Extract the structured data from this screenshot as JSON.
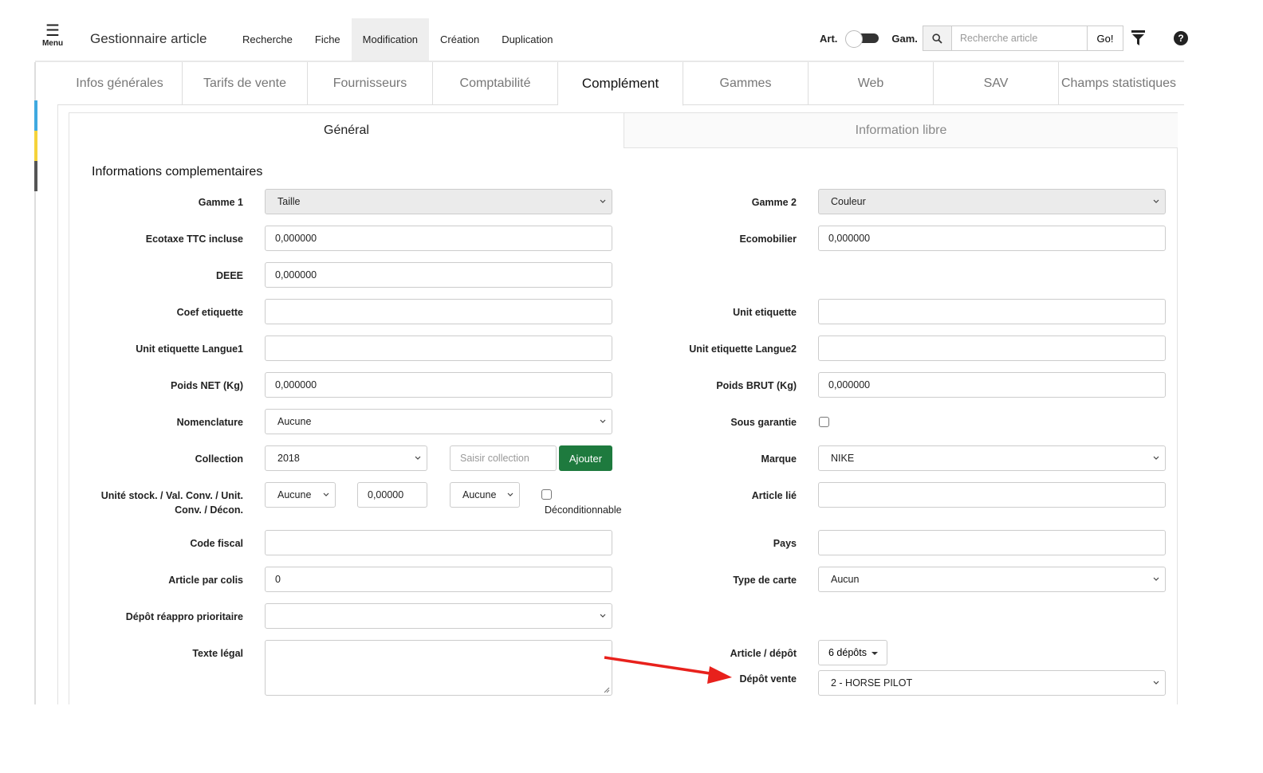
{
  "header": {
    "menu_label": "Menu",
    "app_title": "Gestionnaire article",
    "nav": [
      "Recherche",
      "Fiche",
      "Modification",
      "Création",
      "Duplication"
    ],
    "toggle_left": "Art.",
    "toggle_right": "Gam.",
    "search_placeholder": "Recherche article",
    "go_label": "Go!"
  },
  "tabs": [
    "Infos générales",
    "Tarifs de vente",
    "Fournisseurs",
    "Comptabilité",
    "Complément",
    "Gammes",
    "Web",
    "SAV",
    "Champs statistiques"
  ],
  "active_tab": "Complément",
  "subtabs": [
    "Général",
    "Information libre"
  ],
  "section_title": "Informations complementaires",
  "form": {
    "gamme1": {
      "label": "Gamme 1",
      "value": "Taille"
    },
    "gamme2": {
      "label": "Gamme 2",
      "value": "Couleur"
    },
    "ecotaxe": {
      "label": "Ecotaxe TTC incluse",
      "value": "0,000000"
    },
    "ecomobilier": {
      "label": "Ecomobilier",
      "value": "0,000000"
    },
    "deee": {
      "label": "DEEE",
      "value": "0,000000"
    },
    "coef_etiquette": {
      "label": "Coef etiquette",
      "value": ""
    },
    "unit_etiquette": {
      "label": "Unit etiquette",
      "value": ""
    },
    "unit_langue1": {
      "label": "Unit etiquette Langue1",
      "value": ""
    },
    "unit_langue2": {
      "label": "Unit etiquette Langue2",
      "value": ""
    },
    "poids_net": {
      "label": "Poids NET (Kg)",
      "value": "0,000000"
    },
    "poids_brut": {
      "label": "Poids BRUT (Kg)",
      "value": "0,000000"
    },
    "nomenclature": {
      "label": "Nomenclature",
      "value": "Aucune"
    },
    "sous_garantie": {
      "label": "Sous garantie",
      "checked": false
    },
    "collection": {
      "label": "Collection",
      "value": "2018",
      "input_placeholder": "Saisir collection",
      "button": "Ajouter"
    },
    "marque": {
      "label": "Marque",
      "value": "NIKE"
    },
    "unite_stock": {
      "label_line1": "Unité stock. / Val. Conv. / Unit.",
      "label_line2": "Conv. / Décon.",
      "unit1": "Aucune",
      "val_conv": "0,00000",
      "unit2": "Aucune",
      "decond_label": "Déconditionnable"
    },
    "article_lie": {
      "label": "Article lié",
      "value": ""
    },
    "code_fiscal": {
      "label": "Code fiscal",
      "value": ""
    },
    "pays": {
      "label": "Pays",
      "value": ""
    },
    "article_colis": {
      "label": "Article par colis",
      "value": "0"
    },
    "type_carte": {
      "label": "Type de carte",
      "value": "Aucun"
    },
    "depot_reappro": {
      "label": "Dépôt réappro prioritaire",
      "value": ""
    },
    "texte_legal": {
      "label": "Texte légal",
      "value": ""
    },
    "article_depot": {
      "label": "Article / dépôt",
      "button": "6 dépôts"
    },
    "depot_vente": {
      "label": "Dépôt vente",
      "value": "2 - HORSE PILOT"
    }
  },
  "colors": {
    "accent_green": "#1e7a3e",
    "annotation_arrow": "#e8211c",
    "gutter_blue": "#3fa9e0",
    "gutter_yellow": "#f5d33a",
    "gutter_dark": "#555555"
  }
}
